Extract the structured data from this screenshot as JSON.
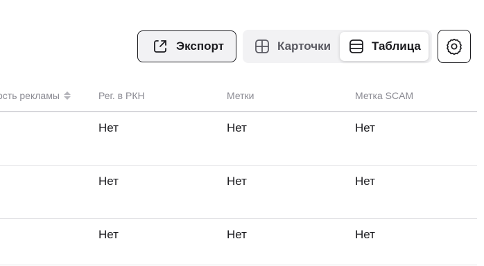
{
  "toolbar": {
    "export_label": "Экспорт",
    "view_cards_label": "Карточки",
    "view_table_label": "Таблица",
    "active_view": "Таблица",
    "icons": {
      "export": "export-icon",
      "cards": "grid-icon",
      "table": "table-rows-icon",
      "settings": "gear-icon"
    }
  },
  "table": {
    "columns": [
      {
        "label": "ость рекламы",
        "sortable": true
      },
      {
        "label": "Рег. в РКН",
        "sortable": false
      },
      {
        "label": "Метки",
        "sortable": false
      },
      {
        "label": "Метка SCAM",
        "sortable": false
      }
    ],
    "rows": [
      {
        "reg_rkn": "Нет",
        "tags": "Нет",
        "scam": "Нет"
      },
      {
        "reg_rkn": "Нет",
        "tags": "Нет",
        "scam": "Нет"
      },
      {
        "reg_rkn": "Нет",
        "tags": "Нет",
        "scam": "Нет"
      }
    ]
  },
  "colors": {
    "text": "#1b1b1f",
    "header_text": "#8a8a92",
    "toggle_bg": "#f2f2f4",
    "divider": "#e3e3e6"
  }
}
